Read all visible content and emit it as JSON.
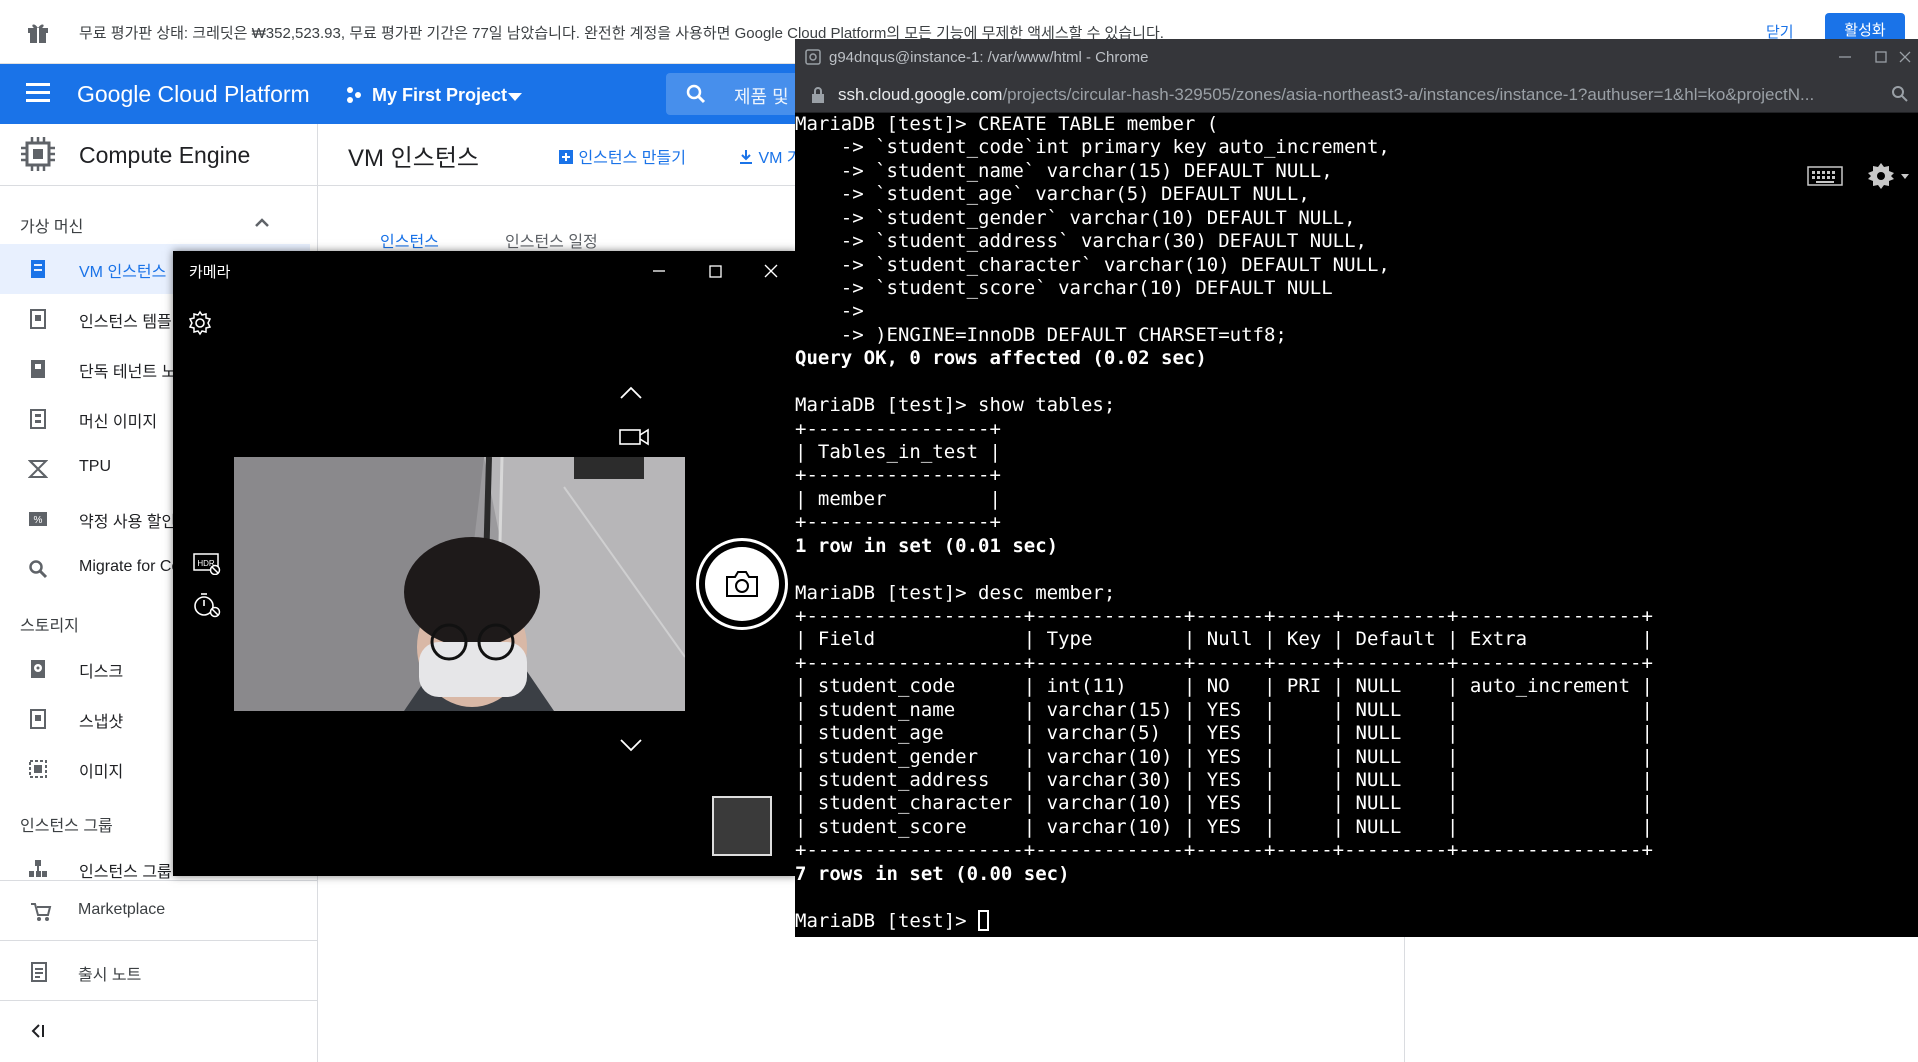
{
  "trial_bar": {
    "message": "무료 평가판 상태: 크레딧은 ₩352,523.93, 무료 평가판 기간은 77일 남았습니다. 완전한 계정을 사용하면 Google Cloud Platform의 모든 기능에 무제한 액세스할 수 있습니다.",
    "dismiss": "닫기",
    "activate": "활성화"
  },
  "header": {
    "brand": "Google Cloud Platform",
    "project": "My First Project",
    "search_placeholder": "제품 및 리소스 검색"
  },
  "sidebar": {
    "product": "Compute Engine",
    "section_vm": "가상 머신",
    "items_vm": [
      {
        "label": "VM 인스턴스",
        "icon": "vm-icon"
      },
      {
        "label": "인스턴스 템플릿",
        "icon": "template-icon"
      },
      {
        "label": "단독 테넌트 노드",
        "icon": "sole-tenant-icon"
      },
      {
        "label": "머신 이미지",
        "icon": "machine-image-icon"
      },
      {
        "label": "TPU",
        "icon": "tpu-icon"
      },
      {
        "label": "약정 사용 할인",
        "icon": "discount-icon"
      },
      {
        "label": "Migrate for Compute Engine",
        "icon": "search-icon"
      }
    ],
    "section_storage": "스토리지",
    "items_storage": [
      {
        "label": "디스크",
        "icon": "disk-icon"
      },
      {
        "label": "스냅샷",
        "icon": "snapshot-icon"
      },
      {
        "label": "이미지",
        "icon": "image-icon"
      }
    ],
    "section_group": "인스턴스 그룹",
    "items_group": [
      {
        "label": "인스턴스 그룹",
        "icon": "instance-group-icon"
      }
    ],
    "marketplace": "Marketplace",
    "release_notes": "출시 노트"
  },
  "content": {
    "title": "VM 인스턴스",
    "create_action": "인스턴스 만들기",
    "import_action": "VM 가져오기",
    "tab_instances": "인스턴스",
    "tab_schedules": "인스턴스 일정"
  },
  "camera": {
    "title": "카메라"
  },
  "chrome": {
    "title": "g94dnqus@instance-1: /var/www/html - Chrome",
    "url_host": "ssh.cloud.google.com",
    "url_path": "/projects/circular-hash-329505/zones/asia-northeast3-a/instances/instance-1?authuser=1&hl=ko&projectN..."
  },
  "terminal": {
    "lines": [
      {
        "text": "MariaDB [test]> CREATE TABLE member (",
        "bold": false
      },
      {
        "text": "    -> `student_code`int primary key auto_increment,",
        "bold": false
      },
      {
        "text": "    -> `student_name` varchar(15) DEFAULT NULL,",
        "bold": false
      },
      {
        "text": "    -> `student_age` varchar(5) DEFAULT NULL,",
        "bold": false
      },
      {
        "text": "    -> `student_gender` varchar(10) DEFAULT NULL,",
        "bold": false
      },
      {
        "text": "    -> `student_address` varchar(30) DEFAULT NULL,",
        "bold": false
      },
      {
        "text": "    -> `student_character` varchar(10) DEFAULT NULL,",
        "bold": false
      },
      {
        "text": "    -> `student_score` varchar(10) DEFAULT NULL",
        "bold": false
      },
      {
        "text": "    ->",
        "bold": false
      },
      {
        "text": "    -> )ENGINE=InnoDB DEFAULT CHARSET=utf8;",
        "bold": false
      },
      {
        "text": "Query OK, 0 rows affected (0.02 sec)",
        "bold": true
      },
      {
        "text": "",
        "bold": false
      },
      {
        "text": "MariaDB [test]> show tables;",
        "bold": false
      },
      {
        "text": "+----------------+",
        "bold": false
      },
      {
        "text": "| Tables_in_test |",
        "bold": false
      },
      {
        "text": "+----------------+",
        "bold": false
      },
      {
        "text": "| member         |",
        "bold": false
      },
      {
        "text": "+----------------+",
        "bold": false
      },
      {
        "text": "1 row in set (0.01 sec)",
        "bold": true
      },
      {
        "text": "",
        "bold": false
      },
      {
        "text": "MariaDB [test]> desc member;",
        "bold": false
      },
      {
        "text": "+-------------------+-------------+------+-----+---------+----------------+",
        "bold": false
      },
      {
        "text": "| Field             | Type        | Null | Key | Default | Extra          |",
        "bold": false
      },
      {
        "text": "+-------------------+-------------+------+-----+---------+----------------+",
        "bold": false
      },
      {
        "text": "| student_code      | int(11)     | NO   | PRI | NULL    | auto_increment |",
        "bold": false
      },
      {
        "text": "| student_name      | varchar(15) | YES  |     | NULL    |                |",
        "bold": false
      },
      {
        "text": "| student_age       | varchar(5)  | YES  |     | NULL    |                |",
        "bold": false
      },
      {
        "text": "| student_gender    | varchar(10) | YES  |     | NULL    |                |",
        "bold": false
      },
      {
        "text": "| student_address   | varchar(30) | YES  |     | NULL    |                |",
        "bold": false
      },
      {
        "text": "| student_character | varchar(10) | YES  |     | NULL    |                |",
        "bold": false
      },
      {
        "text": "| student_score     | varchar(10) | YES  |     | NULL    |                |",
        "bold": false
      },
      {
        "text": "+-------------------+-------------+------+-----+---------+----------------+",
        "bold": false
      },
      {
        "text": "7 rows in set (0.00 sec)",
        "bold": true
      },
      {
        "text": "",
        "bold": false
      },
      {
        "text": "MariaDB [test]> ",
        "bold": false
      }
    ]
  },
  "colors": {
    "gcp_blue": "#1a73e8",
    "terminal_bg": "#000000",
    "chrome_frame": "#35363a"
  }
}
